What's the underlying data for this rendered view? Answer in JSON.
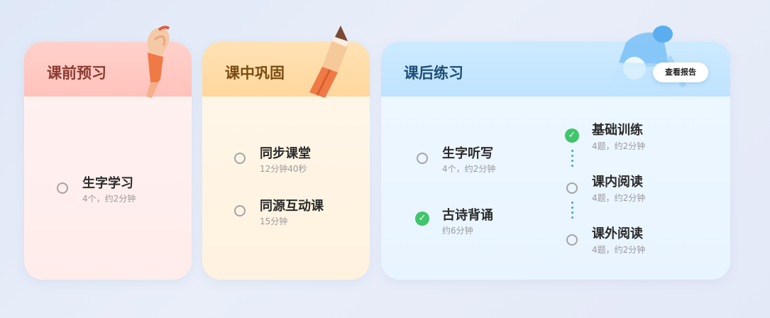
{
  "cards": [
    {
      "title": "课前预习",
      "items": [
        {
          "title": "生字学习",
          "sub": "4个，约2分钟",
          "done": false
        }
      ]
    },
    {
      "title": "课中巩固",
      "items": [
        {
          "title": "同步课堂",
          "sub": "12分钟40秒",
          "done": false
        },
        {
          "title": "同源互动课",
          "sub": "15分钟",
          "done": false
        }
      ]
    },
    {
      "title": "课后练习",
      "report_button": "查看报告",
      "left_items": [
        {
          "title": "生字听写",
          "sub": "4个，约2分钟",
          "done": false
        },
        {
          "title": "古诗背诵",
          "sub": "约6分钟",
          "done": true
        }
      ],
      "right_items": [
        {
          "title": "基础训练",
          "sub": "4题，约2分钟",
          "done": true
        },
        {
          "title": "课内阅读",
          "sub": "4题，约2分钟",
          "done": false
        },
        {
          "title": "课外阅读",
          "sub": "4题，约2分钟",
          "done": false
        }
      ]
    }
  ],
  "icons": {
    "brush": "paintbrush-icon",
    "pencil": "pencil-icon",
    "lamp": "desk-lamp-icon",
    "check": "check-icon"
  },
  "colors": {
    "preview_accent": "#ffc2bb",
    "consolidate_accent": "#ffd79d",
    "practice_accent": "#bfe3ff",
    "done_green": "#3fc56b"
  }
}
